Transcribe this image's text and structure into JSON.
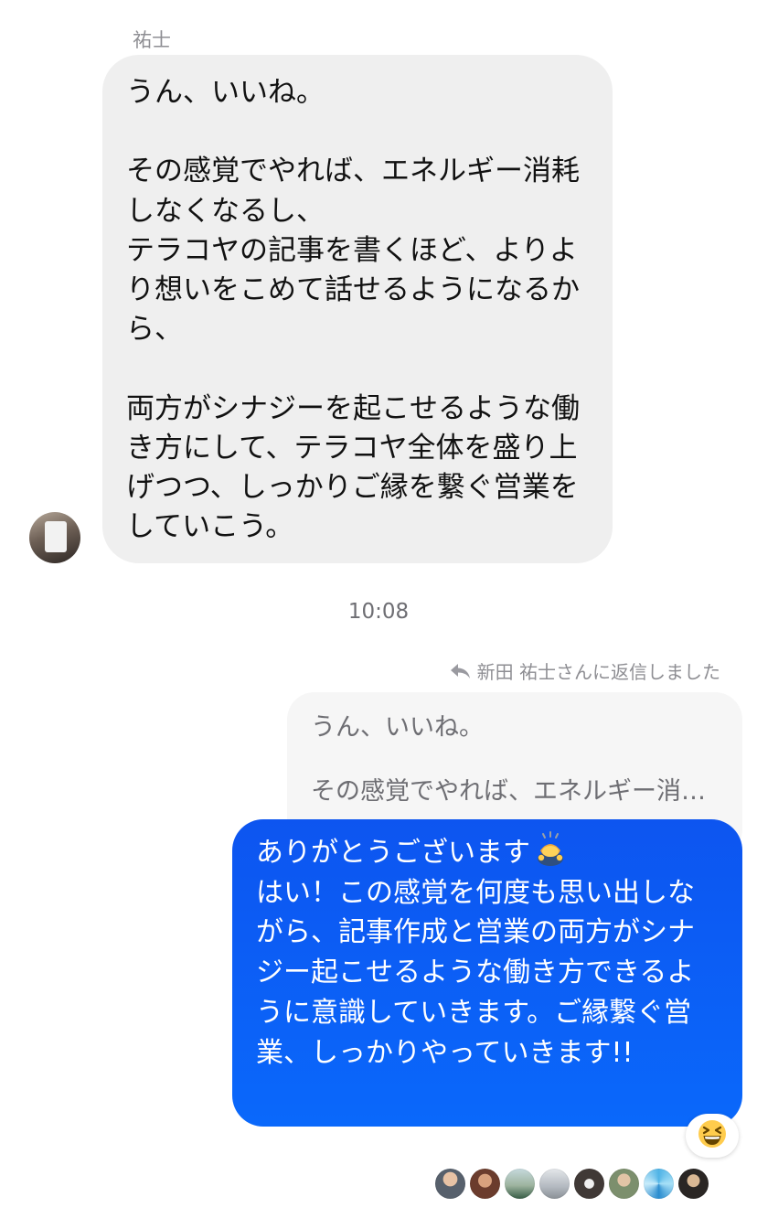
{
  "incoming": {
    "sender_name": "祐士",
    "text": "うん、いいね。\n\nその感覚でやれば、エネルギー消耗\nしなくなるし、\nテラコヤの記事を書くほど、よりよ\nり想いをこめて話せるようになるか\nら、\n\n両方がシナジーを起こせるような働\nき方にして、テラコヤ全体を盛り上\nげつつ、しっかりご縁を繋ぐ営業を\nしていこう。"
  },
  "timestamp": "10:08",
  "reply": {
    "label": "新田 祐士さんに返信しました",
    "icon": "reply-arrow-icon",
    "quoted_line1": "うん、いいね。",
    "quoted_line2": "その感覚でやれば、エネルギー消…"
  },
  "outgoing": {
    "line1": "ありがとうございます",
    "emoji": "person-bowing-emoji",
    "text": "\nはい！この感覚を何度も思い出しな\nがら、記事作成と営業の両方がシナ\nジー起こせるような働き方できるよ\nうに意識していきます。ご縁繋ぐ営\n業、しっかりやっていきます!!",
    "color": "#0a5cf5"
  },
  "reaction": {
    "emoji": "grinning-squinting-face-emoji"
  },
  "read_receipts": [
    "reader-avatar",
    "reader-avatar",
    "reader-avatar",
    "reader-avatar",
    "reader-avatar",
    "reader-avatar",
    "reader-avatar",
    "reader-avatar"
  ]
}
